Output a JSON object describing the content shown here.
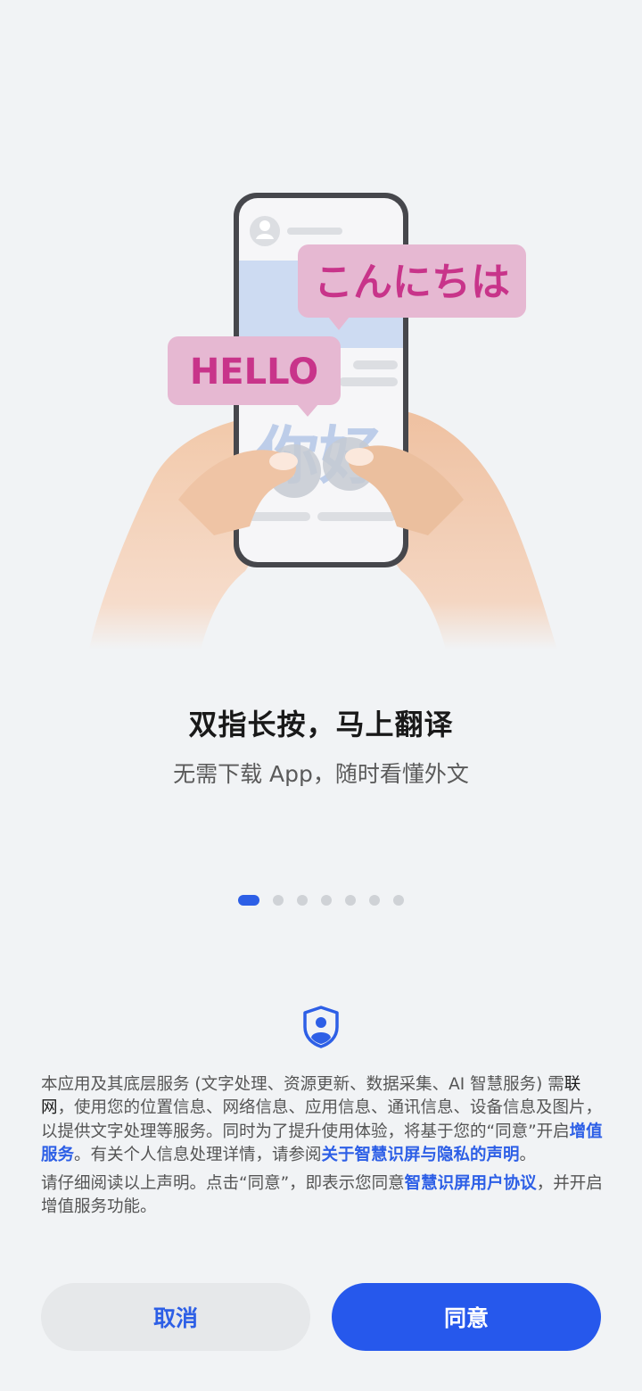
{
  "illustration": {
    "bubble_japanese": "こんにちは",
    "bubble_english": "HELLO",
    "screen_text_chinese": "你好"
  },
  "feature": {
    "title": "双指长按，马上翻译",
    "subtitle": "无需下载 App，随时看懂外文"
  },
  "pager": {
    "total": 7,
    "active_index": 0
  },
  "notice": {
    "p1_text1": "本应用及其底层服务 (文字处理、资源更新、数据采集、AI 智慧服务) 需",
    "p1_em": "联网",
    "p1_text2": "，使用您的位置信息、网络信息、应用信息、通讯信息、设备信息及图片，以提供文字处理等服务。同时为了提升使用体验，将基于您的“同意”开启",
    "p1_link1": "增值服务",
    "p1_text3": "。有关个人信息处理详情，请参阅",
    "p1_link2": "关于智慧识屏与隐私的声明",
    "p1_text4": "。",
    "p2_text1": "请仔细阅读以上声明。点击“同意”，即表示您同意",
    "p2_link": "智慧识屏用户协议",
    "p2_text2": "，并开启增值服务功能。"
  },
  "buttons": {
    "cancel": "取消",
    "agree": "同意"
  },
  "colors": {
    "accent": "#2d5fe6",
    "background": "#f1f3f5",
    "bubble_fill": "#e6b8d2",
    "bubble_text": "#c8348a"
  }
}
